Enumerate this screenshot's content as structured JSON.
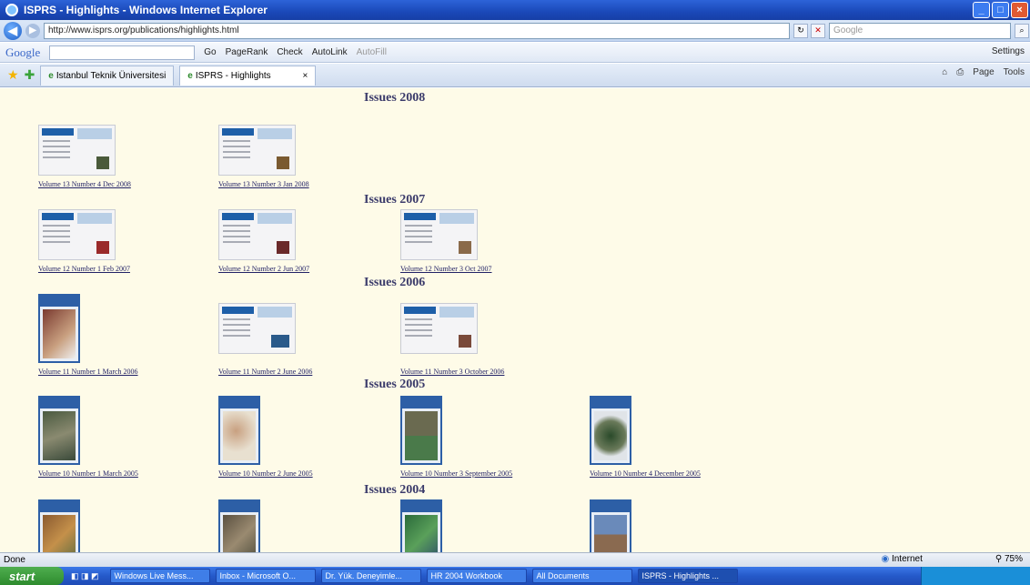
{
  "window": {
    "title": "ISPRS - Highlights - Windows Internet Explorer"
  },
  "address_bar": {
    "url": "http://www.isprs.org/publications/highlights.html",
    "search_placeholder": "Google"
  },
  "google_toolbar": {
    "logo": "Google",
    "go": "Go",
    "pagerank": "PageRank",
    "check": "Check",
    "autolink": "AutoLink",
    "autofill": "AutoFill",
    "settings": "Settings"
  },
  "tabs": [
    {
      "label": "Istanbul Teknik Üniversitesi"
    },
    {
      "label": "ISPRS - Highlights"
    }
  ],
  "command_bar": {
    "page": "Page",
    "tools": "Tools"
  },
  "content": {
    "sections": [
      {
        "year": "Issues 2008",
        "items": [
          {
            "label": "Volume 13 Number 4 Dec 2008"
          },
          {
            "label": "Volume 13 Number 3 Jan 2008"
          }
        ]
      },
      {
        "year": "Issues 2007",
        "items": [
          {
            "label": "Volume 12 Number 1 Feb 2007"
          },
          {
            "label": "Volume 12 Number 2 Jun 2007"
          },
          {
            "label": "Volume 12 Number 3 Oct 2007"
          }
        ]
      },
      {
        "year": "Issues 2006",
        "items": [
          {
            "label": "Volume 11 Number 1 March 2006"
          },
          {
            "label": "Volume 11 Number 2 June 2006"
          },
          {
            "label": "Volume 11 Number 3 October 2006"
          }
        ]
      },
      {
        "year": "Issues 2005",
        "items": [
          {
            "label": "Volume 10 Number 1 March 2005"
          },
          {
            "label": "Volume 10 Number 2 June 2005"
          },
          {
            "label": "Volume 10 Number 3 September 2005"
          },
          {
            "label": "Volume 10 Number 4 December 2005"
          }
        ]
      },
      {
        "year": "Issues 2004",
        "items": []
      }
    ]
  },
  "status_bar": {
    "left": "Done",
    "zone": "Internet",
    "zoom": "75%"
  },
  "taskbar": {
    "start": "start",
    "buttons": [
      "Windows Live Mess...",
      "Inbox - Microsoft O...",
      "Dr. Yük. Deneyimle...",
      "HR 2004 Workbook",
      "All Documents",
      "ISPRS - Highlights ..."
    ]
  }
}
